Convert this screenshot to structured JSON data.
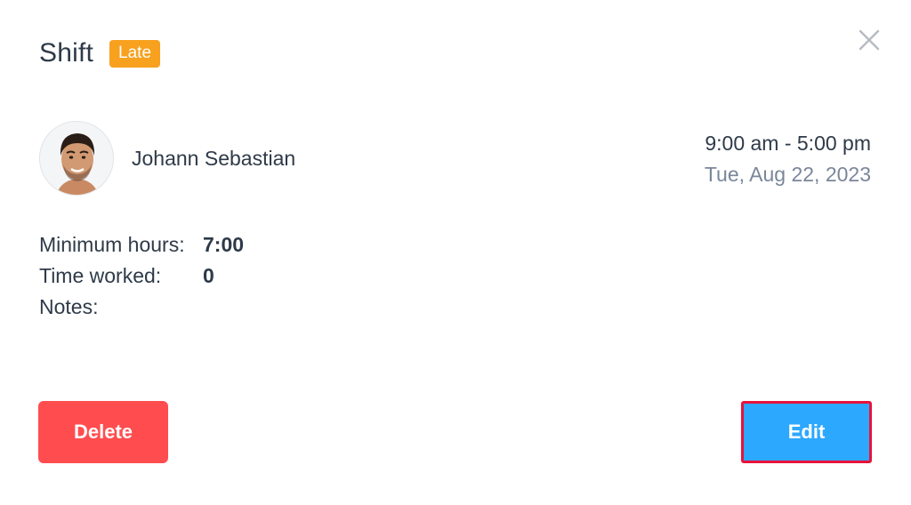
{
  "dialog": {
    "title": "Shift",
    "status_badge": "Late",
    "close_icon": "close-icon"
  },
  "employee": {
    "name": "Johann Sebastian",
    "avatar_icon": "avatar"
  },
  "shift": {
    "time_range": "9:00 am - 5:00 pm",
    "date": "Tue, Aug 22, 2023"
  },
  "details": {
    "minimum_hours_label": "Minimum hours:",
    "minimum_hours_value": "7:00",
    "time_worked_label": "Time worked:",
    "time_worked_value": "0",
    "notes_label": "Notes:"
  },
  "actions": {
    "delete_label": "Delete",
    "edit_label": "Edit"
  },
  "colors": {
    "badge": "#f7a11f",
    "delete": "#ff4d4f",
    "edit": "#2da8ff",
    "highlight_border": "#e8123c"
  }
}
